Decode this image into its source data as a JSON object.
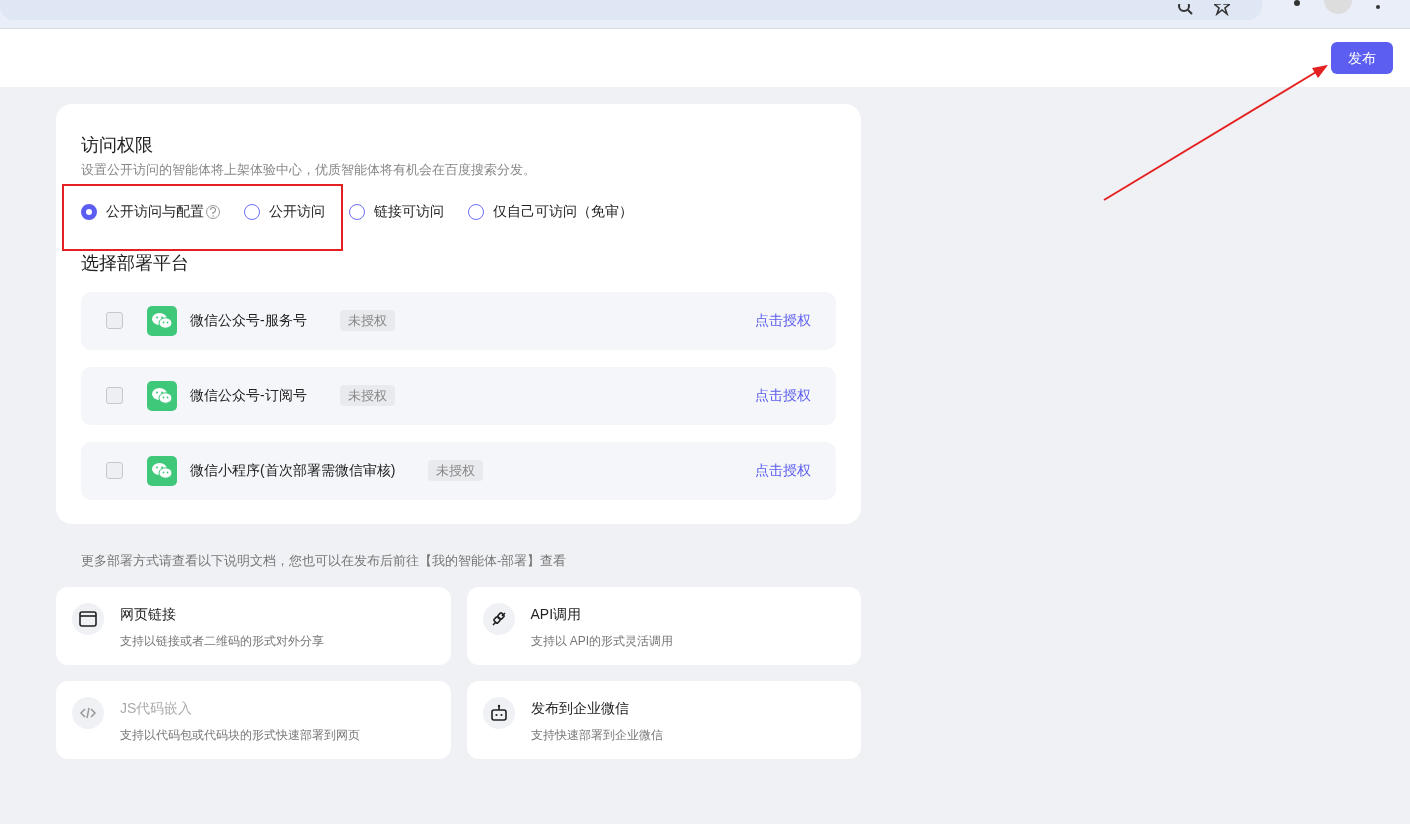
{
  "toolbar": {
    "publish_button": "发布"
  },
  "access": {
    "title": "访问权限",
    "description": "设置公开访问的智能体将上架体验中心，优质智能体将有机会在百度搜索分发。",
    "options": [
      {
        "label": "公开访问与配置",
        "selected": true,
        "help": true
      },
      {
        "label": "公开访问",
        "selected": false,
        "help": false
      },
      {
        "label": "链接可访问",
        "selected": false,
        "help": false
      },
      {
        "label": "仅自己可访问（免审）",
        "selected": false,
        "help": false
      }
    ]
  },
  "platforms": {
    "title": "选择部署平台",
    "items": [
      {
        "name": "微信公众号-服务号",
        "status": "未授权",
        "action": "点击授权",
        "checked": false
      },
      {
        "name": "微信公众号-订阅号",
        "status": "未授权",
        "action": "点击授权",
        "checked": false
      },
      {
        "name": "微信小程序(首次部署需微信审核)",
        "status": "未授权",
        "action": "点击授权",
        "checked": false
      }
    ]
  },
  "note": "更多部署方式请查看以下说明文档，您也可以在发布后前往【我的智能体-部署】查看",
  "deploy_methods": [
    {
      "kind": "web",
      "title": "网页链接",
      "description": "支持以链接或者二维码的形式对外分享",
      "disabled": false
    },
    {
      "kind": "api",
      "title": "API调用",
      "description": "支持以 API的形式灵活调用",
      "disabled": false
    },
    {
      "kind": "code",
      "title": "JS代码嵌入",
      "description": "支持以代码包或代码块的形式快速部署到网页",
      "disabled": true
    },
    {
      "kind": "bot",
      "title": "发布到企业微信",
      "description": "支持快速部署到企业微信",
      "disabled": false
    }
  ]
}
